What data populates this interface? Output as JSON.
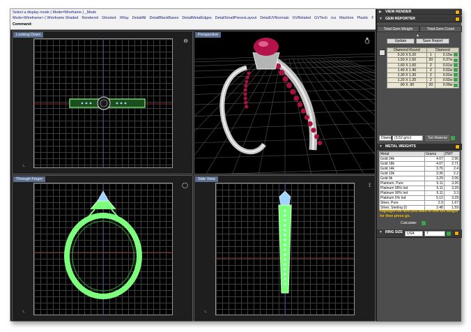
{
  "command": {
    "line1": "Select a display mode ( Mode=Wireframe ) _Mode",
    "line2_prefix": "Mode<Wireframe> ( Wireframe",
    "options": [
      "Shaded",
      "Rendered",
      "Ghosted",
      "XRay",
      "DetailAll",
      "DetailBlackBases",
      "DetailMetalEdges",
      "DetailSmallPiecesLayout",
      "DetailUVNormals",
      "GVRelated",
      "GVTech",
      "ica",
      "Machine",
      "Plastic",
      "Presentation"
    ],
    "line3": "Command:"
  },
  "viewports": {
    "top": {
      "title": "Looking Down"
    },
    "perspective": {
      "title": "Perspective"
    },
    "front": {
      "title": "Through Finger"
    },
    "right": {
      "title": "Side View"
    }
  },
  "panel": {
    "view_render": "VIEW RENDER",
    "gem_reporter": "GEM REPORTER",
    "tabs": [
      "Total Gem Weight",
      "Total Gem Count"
    ],
    "update_label": "Update",
    "save_report_label": "Save Report",
    "gem_headers": [
      "Diamond Round",
      "Diamond"
    ],
    "gems": [
      {
        "size": "5.20 X 5.20",
        "count": "1",
        "weight": "0.15w"
      },
      {
        "size": "1.50 X 1.50",
        "count": "20",
        "weight": "0.37w"
      },
      {
        "size": "1.60 X 1.60",
        "count": "2",
        "weight": "0.01w"
      },
      {
        "size": "1.40 X 1.40",
        "count": "2",
        "weight": "0.02w"
      },
      {
        "size": "1.30 X 1.30",
        "count": "2",
        "weight": "0.02w"
      },
      {
        "size": "1.20 X 1.20",
        "count": "2",
        "weight": "0.02w"
      },
      {
        "size": ".90 X .90",
        "count": "20",
        "weight": "0.09w"
      }
    ],
    "material_label": "Diamond",
    "material_value": "(3.52 g/cc)",
    "set_material_label": "Set Material",
    "metal_weights": "METAL WEIGHTS",
    "metal_headers": [
      "Metal",
      "Grams",
      "DWT"
    ],
    "metals": [
      {
        "metal": "Gold 24k",
        "grams": "4.07",
        "dwt": "2.96"
      },
      {
        "metal": "Gold 18k",
        "grams": "4.07",
        "dwt": "2.71"
      },
      {
        "metal": "Gold 14k",
        "grams": "3.76",
        "dwt": "2.4"
      },
      {
        "metal": "Gold 10k",
        "grams": "3.36",
        "dwt": "2.2"
      },
      {
        "metal": "Gold 9k",
        "grams": "3.29",
        "dwt": "2.06"
      },
      {
        "metal": "Platinum, Pure",
        "grams": "5.11",
        "dwt": "3.26"
      },
      {
        "metal": "Platinum 95% Ind",
        "grams": "5.11",
        "dwt": "3.29"
      },
      {
        "metal": "Platinum 90% Ind",
        "grams": "5.11",
        "dwt": "3.3"
      },
      {
        "metal": "Platinum 5% Ind",
        "grams": "5.12",
        "dwt": "3.29"
      },
      {
        "metal": "Silver, Pure",
        "grams": "2.9",
        "dwt": "1.67"
      },
      {
        "metal": "Silver, Sterling (I)",
        "grams": "2.48",
        "dwt": "1.59"
      }
    ],
    "hint": "Highlight the item you want to find the weight for then press go.",
    "calculate_label": "Calculate:",
    "ring_size": "RING SIZE",
    "ring_size_system": "USA",
    "ring_size_value": "7"
  },
  "colors": {
    "wire": "#7dff7d",
    "gem": "#b3124a",
    "panel_bg": "#4d4d4d"
  }
}
